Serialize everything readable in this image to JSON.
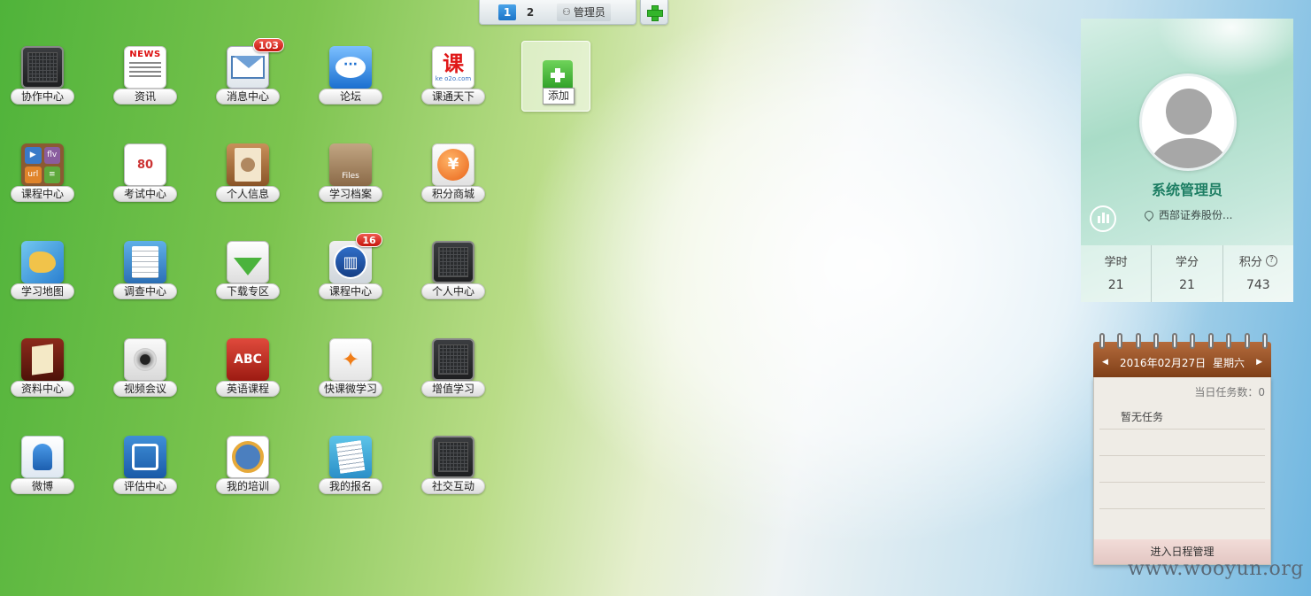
{
  "topbar": {
    "tabs": [
      {
        "label": "1",
        "active": true
      },
      {
        "label": "2",
        "active": false
      }
    ],
    "user_label": "管理员",
    "add_icon": "plus-icon"
  },
  "apps": [
    {
      "label": "协作中心",
      "icon": "collab-icon"
    },
    {
      "label": "资讯",
      "icon": "news-icon",
      "icon_text": "NEWS"
    },
    {
      "label": "消息中心",
      "icon": "mail-icon",
      "badge": "103"
    },
    {
      "label": "论坛",
      "icon": "chat-bubble-icon",
      "icon_text": "···"
    },
    {
      "label": "课通天下",
      "icon": "ketong-logo-icon",
      "icon_text": "课",
      "icon_sub": "ke o2o.com"
    },
    {
      "label": "课程中心",
      "icon": "course-media-icon",
      "icon_cells": [
        "▶",
        "flv",
        "url",
        "≡"
      ]
    },
    {
      "label": "考试中心",
      "icon": "exam-icon",
      "icon_text": "80"
    },
    {
      "label": "个人信息",
      "icon": "contact-book-icon"
    },
    {
      "label": "学习档案",
      "icon": "files-icon",
      "icon_text": "Files"
    },
    {
      "label": "积分商城",
      "icon": "yen-coin-icon",
      "icon_text": "¥"
    },
    {
      "label": "学习地图",
      "icon": "map-icon"
    },
    {
      "label": "调查中心",
      "icon": "survey-doc-icon"
    },
    {
      "label": "下载专区",
      "icon": "download-icon"
    },
    {
      "label": "课程中心",
      "icon": "book-icon",
      "badge": "16"
    },
    {
      "label": "个人中心",
      "icon": "personal-center-icon"
    },
    {
      "label": "资料中心",
      "icon": "library-book-icon"
    },
    {
      "label": "视频会议",
      "icon": "webcam-icon"
    },
    {
      "label": "英语课程",
      "icon": "abc-book-icon",
      "icon_text": "ABC"
    },
    {
      "label": "快课微学习",
      "icon": "runner-icon",
      "icon_text": "✦"
    },
    {
      "label": "增值学习",
      "icon": "value-learning-icon"
    },
    {
      "label": "微博",
      "icon": "weibo-mic-icon"
    },
    {
      "label": "评估中心",
      "icon": "evaluation-icon"
    },
    {
      "label": "我的培训",
      "icon": "training-group-icon"
    },
    {
      "label": "我的报名",
      "icon": "signup-form-icon"
    },
    {
      "label": "社交互动",
      "icon": "social-icon"
    }
  ],
  "add_tile": {
    "label": "添加"
  },
  "profile": {
    "name": "系统管理员",
    "org": "西部证券股份...",
    "stats": [
      {
        "label": "学时",
        "value": "21"
      },
      {
        "label": "学分",
        "value": "21"
      },
      {
        "label": "积分",
        "value": "743",
        "help": "?"
      }
    ]
  },
  "calendar": {
    "prev": "◀",
    "next": "▶",
    "date": "2016年02月27日",
    "weekday": "星期六",
    "task_count_label": "当日任务数：0",
    "empty_text": "暂无任务",
    "footer_link": "进入日程管理"
  },
  "watermark": "www.wooyun.org",
  "colors": {
    "accent_blue": "#1b74c8",
    "badge_red": "#c5160e",
    "profile_name": "#1d7e63",
    "calendar_header": "#8b4a22"
  }
}
